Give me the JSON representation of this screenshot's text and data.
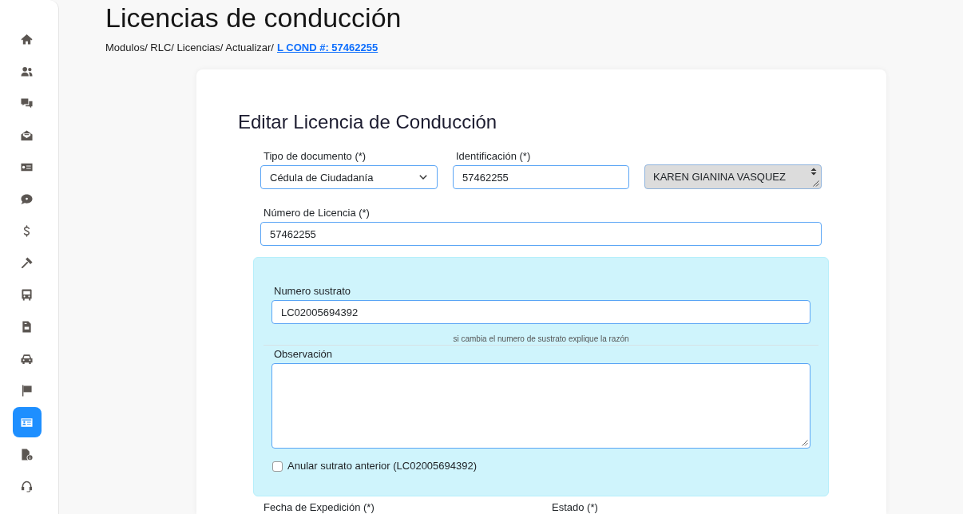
{
  "sidebar": {
    "items": [
      {
        "selected": false
      },
      {
        "selected": false
      },
      {
        "selected": false
      },
      {
        "selected": false
      },
      {
        "selected": false
      },
      {
        "selected": false
      },
      {
        "selected": false
      },
      {
        "selected": false
      },
      {
        "selected": false
      },
      {
        "selected": false
      },
      {
        "selected": false
      },
      {
        "selected": false
      },
      {
        "selected": true
      },
      {
        "selected": false
      },
      {
        "selected": false
      }
    ]
  },
  "header": {
    "title": "Licencias de conducción",
    "breadcrumb": "Modulos/ RLC/ Licencias/ Actualizar/",
    "breadcrumb_link": "L COND #: 57462255"
  },
  "form": {
    "title": "Editar Licencia de Conducción",
    "document_type": {
      "label": "Tipo de documento (*)",
      "value": "Cédula de Ciudadanía"
    },
    "identification": {
      "label": "Identificación (*)",
      "value": "57462255"
    },
    "holder_name": {
      "value": "KAREN GIANINA VASQUEZ",
      "disabled": true
    },
    "license_number": {
      "label": "Número de Licencia (*)",
      "value": "57462255"
    },
    "substrate_panel": {
      "substrate": {
        "label": "Numero sustrato",
        "value": "LC02005694392"
      },
      "hint": "si cambia el numero de sustrato explique la razón",
      "observation": {
        "label": "Observación"
      },
      "void_previous": {
        "label": "Anular sutrato anterior (LC02005694392)",
        "checked": false
      }
    },
    "next_fields": [
      {
        "label": "Fecha de Expedición (*)"
      },
      {
        "label": "Estado (*)"
      }
    ]
  }
}
